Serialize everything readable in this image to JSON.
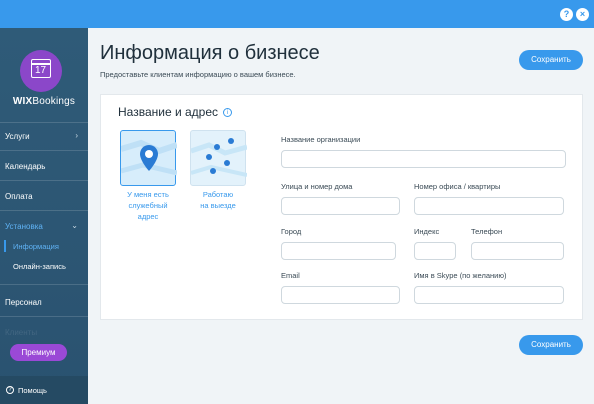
{
  "topbar": {
    "help_label": "?",
    "close_label": "×"
  },
  "sidebar": {
    "logo_number": "17",
    "brand_prefix": "WIX",
    "brand_suffix": "Bookings",
    "items": [
      {
        "label": "Услуги"
      },
      {
        "label": "Календарь"
      },
      {
        "label": "Оплата"
      },
      {
        "label": "Установка"
      },
      {
        "label": "Персонал"
      },
      {
        "label": "Клиенты"
      }
    ],
    "subitems": [
      {
        "label": "Информация"
      },
      {
        "label": "Онлайн-запись"
      }
    ],
    "premium_label": "Премиум",
    "help_label": "Помощь"
  },
  "main": {
    "title": "Информация о бизнесе",
    "subtitle": "Предоставьте клиентам информацию о вашем бизнесе.",
    "save_label_top": "Сохранить",
    "save_label_bottom": "Сохранить"
  },
  "card": {
    "title": "Название и адрес",
    "options": [
      {
        "label_line1": "У меня есть",
        "label_line2": "служебный",
        "label_line3": "адрес"
      },
      {
        "label_line1": "Работаю",
        "label_line2": "на выезде"
      }
    ],
    "fields": {
      "org_name_label": "Название организации",
      "street_label": "Улица и номер дома",
      "office_label": "Номер офиса / квартиры",
      "city_label": "Город",
      "zip_label": "Индекс",
      "phone_label": "Телефон",
      "email_label": "Email",
      "skype_label": "Имя в Skype (по желанию)"
    }
  },
  "colors": {
    "accent": "#3899ec",
    "sidebar": "#2b5672",
    "premium": "#9a49d6",
    "logo": "#8b47c9"
  }
}
